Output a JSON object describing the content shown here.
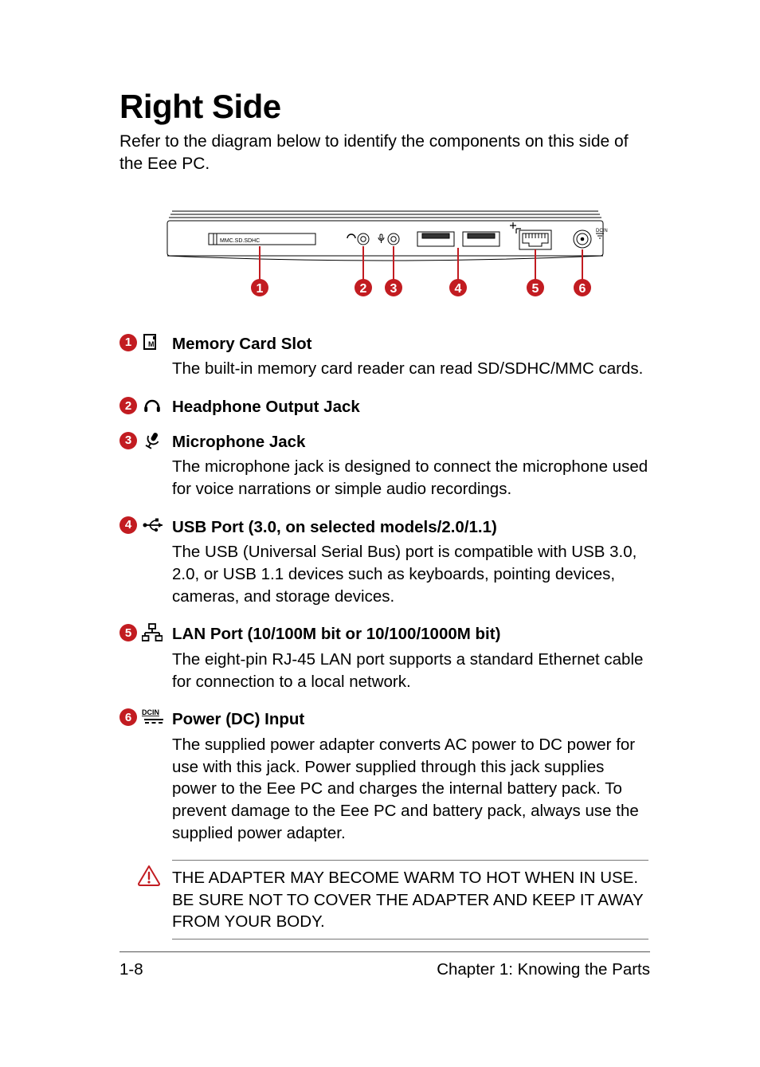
{
  "heading": "Right Side",
  "intro": "Refer to the diagram below to identify the components on this side of the Eee PC.",
  "diagram": {
    "slot_label": "MMC.SD.SDHC",
    "dcin_label": "DCIN",
    "callouts": [
      "1",
      "2",
      "3",
      "4",
      "5",
      "6"
    ]
  },
  "items": [
    {
      "num": "1",
      "icon": "memory-card-icon",
      "title": "Memory Card Slot",
      "desc": "The built-in memory card reader can read SD/SDHC/MMC cards."
    },
    {
      "num": "2",
      "icon": "headphone-icon",
      "title": "Headphone Output Jack",
      "desc": ""
    },
    {
      "num": "3",
      "icon": "microphone-icon",
      "title": "Microphone Jack",
      "desc": "The microphone jack is designed to connect the microphone used for voice narrations or simple audio recordings."
    },
    {
      "num": "4",
      "icon": "usb-icon",
      "title": "USB Port (3.0, on selected models/2.0/1.1)",
      "desc": "The USB (Universal Serial Bus) port is compatible with USB 3.0, 2.0, or USB 1.1 devices such as keyboards, pointing devices, cameras, and storage devices."
    },
    {
      "num": "5",
      "icon": "lan-icon",
      "title": "LAN Port (10/100M bit or 10/100/1000M bit)",
      "desc": "The eight-pin RJ-45 LAN port supports a standard Ethernet cable for connection to a local network."
    },
    {
      "num": "6",
      "icon": "dcin-icon",
      "title": "Power (DC) Input",
      "desc": "The supplied power adapter converts AC power to DC power for use with this jack. Power supplied through this jack supplies power to the Eee PC and charges the internal battery pack. To prevent damage to the Eee PC and battery pack, always use the supplied power adapter."
    }
  ],
  "warning": "THE ADAPTER MAY BECOME WARM TO HOT WHEN IN USE. BE SURE NOT TO COVER THE ADAPTER AND KEEP IT AWAY FROM YOUR BODY.",
  "footer": {
    "left": "1-8",
    "right": "Chapter 1: Knowing the Parts"
  }
}
